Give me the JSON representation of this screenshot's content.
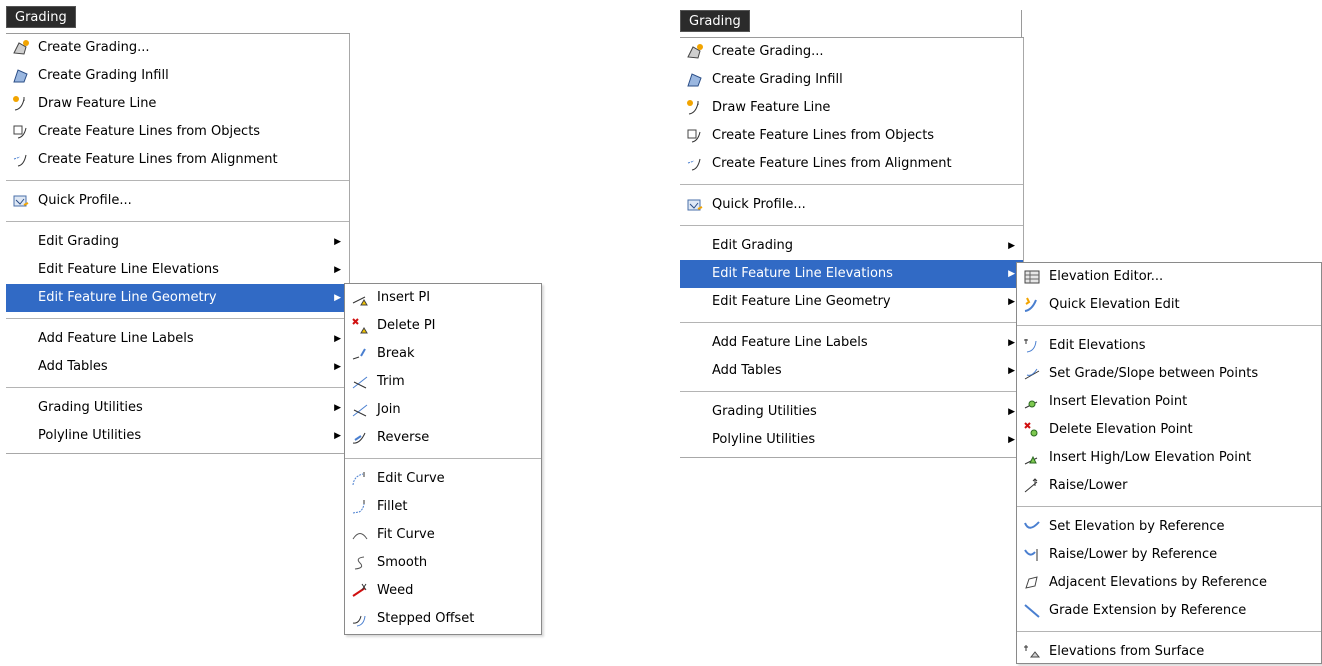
{
  "left": {
    "menu_title": "Grading",
    "items": [
      {
        "label": "Create Grading...",
        "icon": "create-grading-icon"
      },
      {
        "label": "Create Grading Infill",
        "icon": "grading-infill-icon"
      },
      {
        "label": "Draw Feature Line",
        "icon": "draw-feature-line-icon"
      },
      {
        "label": "Create Feature Lines from Objects",
        "icon": "feature-lines-objects-icon"
      },
      {
        "label": "Create Feature Lines from Alignment",
        "icon": "feature-lines-alignment-icon"
      },
      {
        "label": "Quick Profile...",
        "icon": "quick-profile-icon"
      },
      {
        "label": "Edit Grading"
      },
      {
        "label": "Edit Feature Line Elevations"
      },
      {
        "label": "Edit Feature Line Geometry"
      },
      {
        "label": "Add Feature Line Labels"
      },
      {
        "label": "Add Tables"
      },
      {
        "label": "Grading Utilities"
      },
      {
        "label": "Polyline Utilities"
      }
    ],
    "submenu": [
      {
        "label": "Insert PI",
        "icon": "insert-pi-icon"
      },
      {
        "label": "Delete PI",
        "icon": "delete-pi-icon"
      },
      {
        "label": "Break",
        "icon": "break-icon"
      },
      {
        "label": "Trim",
        "icon": "trim-icon"
      },
      {
        "label": "Join",
        "icon": "join-icon"
      },
      {
        "label": "Reverse",
        "icon": "reverse-icon"
      },
      {
        "label": "Edit Curve",
        "icon": "edit-curve-icon"
      },
      {
        "label": "Fillet",
        "icon": "fillet-icon"
      },
      {
        "label": "Fit Curve",
        "icon": "fit-curve-icon"
      },
      {
        "label": "Smooth",
        "icon": "smooth-icon"
      },
      {
        "label": "Weed",
        "icon": "weed-icon"
      },
      {
        "label": "Stepped Offset",
        "icon": "stepped-offset-icon"
      }
    ]
  },
  "right": {
    "menu_title": "Grading",
    "items": [
      {
        "label": "Create Grading..."
      },
      {
        "label": "Create Grading Infill"
      },
      {
        "label": "Draw Feature Line"
      },
      {
        "label": "Create Feature Lines from Objects"
      },
      {
        "label": "Create Feature Lines from Alignment"
      },
      {
        "label": "Quick Profile..."
      },
      {
        "label": "Edit Grading"
      },
      {
        "label": "Edit Feature Line Elevations"
      },
      {
        "label": "Edit Feature Line Geometry"
      },
      {
        "label": "Add Feature Line Labels"
      },
      {
        "label": "Add Tables"
      },
      {
        "label": "Grading Utilities"
      },
      {
        "label": "Polyline Utilities"
      }
    ],
    "submenu": [
      {
        "label": "Elevation Editor...",
        "icon": "elevation-editor-icon"
      },
      {
        "label": "Quick Elevation Edit",
        "icon": "quick-elevation-edit-icon"
      },
      {
        "label": "Edit Elevations",
        "icon": "edit-elevations-icon"
      },
      {
        "label": "Set Grade/Slope between Points",
        "icon": "set-grade-slope-icon"
      },
      {
        "label": "Insert Elevation Point",
        "icon": "insert-elevation-point-icon"
      },
      {
        "label": "Delete Elevation Point",
        "icon": "delete-elevation-point-icon"
      },
      {
        "label": "Insert High/Low Elevation Point",
        "icon": "insert-high-low-icon"
      },
      {
        "label": "Raise/Lower",
        "icon": "raise-lower-icon"
      },
      {
        "label": "Set Elevation by Reference",
        "icon": "set-elevation-reference-icon"
      },
      {
        "label": "Raise/Lower by Reference",
        "icon": "raise-lower-reference-icon"
      },
      {
        "label": "Adjacent Elevations by Reference",
        "icon": "adjacent-elevations-icon"
      },
      {
        "label": "Grade Extension by Reference",
        "icon": "grade-extension-icon"
      },
      {
        "label": "Elevations from Surface",
        "icon": "elevations-surface-icon"
      }
    ]
  },
  "colors": {
    "highlight": "#316ac5",
    "title_bg": "#2b2b2b"
  }
}
